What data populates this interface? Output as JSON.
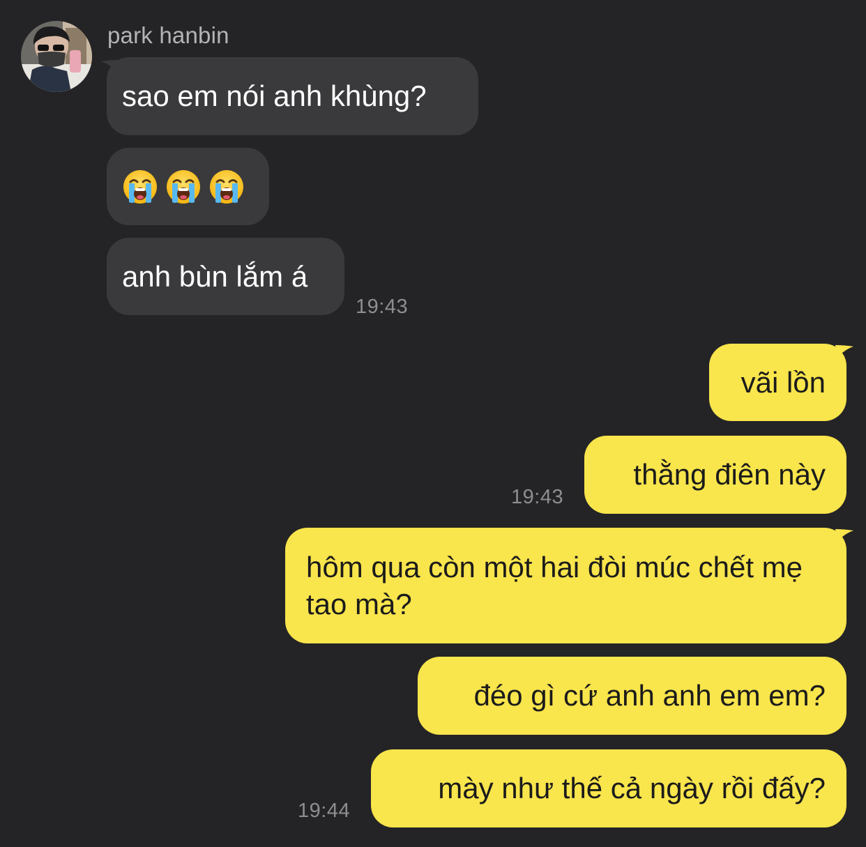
{
  "sender": {
    "name": "park hanbin",
    "avatar_icon": "profile-photo-avatar"
  },
  "incoming": [
    {
      "text": "sao em nói anh khùng?"
    },
    {
      "emoji_icon": "loudly-crying-face-icon",
      "count": 3
    },
    {
      "text": "anh bùn lắm á"
    }
  ],
  "incoming_time": "19:43",
  "outgoing": [
    {
      "text": "vãi lồn"
    },
    {
      "text": "thằng điên này"
    },
    {
      "text": "hôm qua còn một hai đòi múc chết mẹ tao mà?"
    },
    {
      "text": "đéo gì cứ anh anh em em?"
    },
    {
      "text": "mày như thế cả ngày rồi đấy?"
    }
  ],
  "outgoing_time_1": "19:43",
  "outgoing_time_2": "19:44",
  "colors": {
    "background": "#242426",
    "incoming_bubble": "#3a3a3c",
    "outgoing_bubble": "#f9e54c",
    "timestamp": "#8e8e92"
  }
}
